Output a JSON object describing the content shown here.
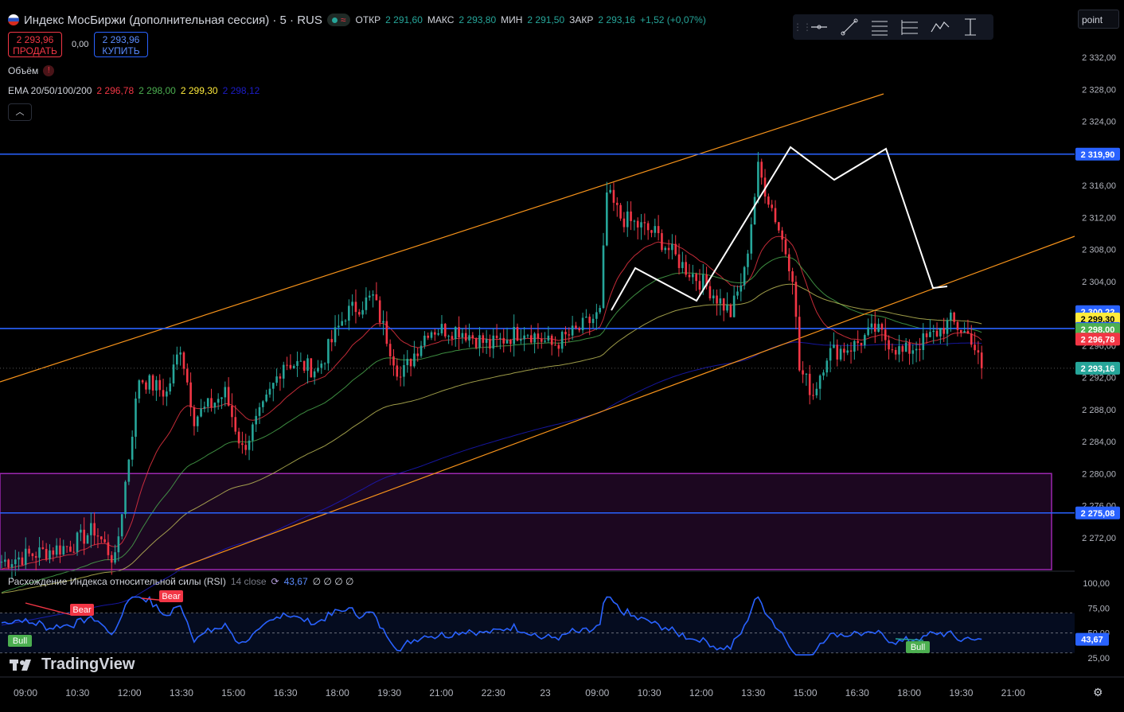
{
  "header": {
    "symbol_title": "Индекс МосБиржи (дополнительная сессия) · 5 · RUS",
    "ohlc": [
      {
        "label": "ОТКР",
        "value": "2 291,60"
      },
      {
        "label": "МАКС",
        "value": "2 293,80"
      },
      {
        "label": "МИН",
        "value": "2 291,50"
      },
      {
        "label": "ЗАКР",
        "value": "2 293,16"
      }
    ],
    "change": "+1,52 (+0,07%)"
  },
  "trade": {
    "sell_price": "2 293,96",
    "sell_label": "ПРОДАТЬ",
    "spread": "0,00",
    "buy_price": "2 293,96",
    "buy_label": "КУПИТЬ"
  },
  "indicators": {
    "volume_label": "Объём",
    "ema_label": "EMA 20/50/100/200",
    "ema_values": [
      {
        "value": "2 296,78",
        "color": "#f23645"
      },
      {
        "value": "2 298,00",
        "color": "#4caf50"
      },
      {
        "value": "2 299,30",
        "color": "#ffeb3b"
      },
      {
        "value": "2 298,12",
        "color": "#1c1cc7"
      }
    ]
  },
  "toolbar": {
    "point_value": "point",
    "tools": [
      "horizontal-line-icon",
      "trend-line-icon",
      "fib-retracement-icon",
      "parallel-channel-icon",
      "pattern-icon",
      "vertical-line-icon"
    ]
  },
  "colors": {
    "bull": "#26a69a",
    "bear": "#f23645",
    "hline": "#2962ff",
    "channel": "#f7931a",
    "zone": "#9c27b0",
    "pattern": "#ffffff",
    "rsi": "#2962ff"
  },
  "price_axis": {
    "ticks": [
      "2 332,00",
      "2 328,00",
      "2 324,00",
      "2 320,00",
      "2 316,00",
      "2 312,00",
      "2 308,00",
      "2 304,00",
      "2 300,00",
      "2 296,00",
      "2 292,00",
      "2 288,00",
      "2 284,00",
      "2 280,00",
      "2 276,00",
      "2 272,00"
    ],
    "tick_values": [
      2332,
      2328,
      2324,
      2320,
      2316,
      2312,
      2308,
      2304,
      2300,
      2296,
      2292,
      2288,
      2284,
      2280,
      2276,
      2272
    ],
    "badges": [
      {
        "text": "2 319,90",
        "value": 2319.9,
        "bg": "#2962ff",
        "fg": "#ffffff"
      },
      {
        "text": "2 300,22",
        "value": 2300.22,
        "bg": "#2962ff",
        "fg": "#ffffff"
      },
      {
        "text": "2 299,30",
        "value": 2299.3,
        "bg": "#ffeb3b",
        "fg": "#000000"
      },
      {
        "text": "2 298,12",
        "value": 2298.12,
        "bg": "#2962ff",
        "fg": "#ffffff"
      },
      {
        "text": "2 298,00",
        "value": 2298.0,
        "bg": "#4caf50",
        "fg": "#ffffff"
      },
      {
        "text": "2 296,78",
        "value": 2296.78,
        "bg": "#f23645",
        "fg": "#ffffff"
      },
      {
        "text": "2 293,16",
        "value": 2293.16,
        "bg": "#26a69a",
        "fg": "#ffffff"
      },
      {
        "text": "2 275,08",
        "value": 2275.08,
        "bg": "#2962ff",
        "fg": "#ffffff"
      }
    ]
  },
  "time_axis": {
    "labels": [
      "09:00",
      "10:30",
      "12:00",
      "13:30",
      "15:00",
      "16:30",
      "18:00",
      "19:30",
      "21:00",
      "22:30",
      "23",
      "09:00",
      "10:30",
      "12:00",
      "13:30",
      "15:00",
      "16:30",
      "18:00",
      "19:30",
      "21:00"
    ]
  },
  "levels": {
    "hlines": [
      2319.9,
      2298.12,
      2275.08
    ],
    "zone": {
      "from": 2280.0,
      "to": 2268.0
    }
  },
  "rsi": {
    "legend": "Расхождение Индекса относительной силы (RSI)",
    "params": "14 close",
    "value": "43,67",
    "extras": "∅ ∅ ∅ ∅",
    "axis_ticks": [
      "100,00",
      "75,00",
      "50,00",
      "25,00"
    ],
    "tick_values": [
      100,
      75,
      50,
      25
    ],
    "current": 43.67,
    "band": [
      30,
      70
    ],
    "signals": [
      {
        "text": "Bull",
        "kind": "bull"
      },
      {
        "text": "Bear",
        "kind": "bear"
      },
      {
        "text": "Bear",
        "kind": "bear"
      },
      {
        "text": "Bull",
        "kind": "bull"
      }
    ]
  },
  "chart_data": {
    "type": "candlestick",
    "symbol": "Индекс МосБиржи (дополнительная сессия)",
    "interval": "5",
    "y_range": [
      2268,
      2335
    ],
    "anchors": [
      [
        0,
        2269
      ],
      [
        10,
        2270
      ],
      [
        20,
        2271
      ],
      [
        27,
        2273
      ],
      [
        33,
        2269
      ],
      [
        40,
        2292
      ],
      [
        48,
        2290
      ],
      [
        52,
        2296
      ],
      [
        56,
        2287
      ],
      [
        65,
        2290
      ],
      [
        70,
        2283
      ],
      [
        76,
        2288
      ],
      [
        82,
        2294
      ],
      [
        92,
        2293
      ],
      [
        100,
        2300
      ],
      [
        108,
        2302
      ],
      [
        112,
        2297
      ],
      [
        116,
        2292
      ],
      [
        124,
        2298
      ],
      [
        133,
        2298
      ],
      [
        142,
        2296
      ],
      [
        152,
        2298
      ],
      [
        160,
        2296
      ],
      [
        168,
        2298
      ],
      [
        174,
        2300
      ],
      [
        176,
        2315
      ],
      [
        180,
        2312
      ],
      [
        190,
        2310
      ],
      [
        198,
        2306
      ],
      [
        206,
        2303
      ],
      [
        212,
        2300
      ],
      [
        216,
        2305
      ],
      [
        220,
        2318
      ],
      [
        225,
        2312
      ],
      [
        230,
        2305
      ],
      [
        232,
        2293
      ],
      [
        236,
        2290
      ],
      [
        240,
        2295
      ],
      [
        248,
        2296
      ],
      [
        254,
        2298
      ],
      [
        262,
        2295
      ],
      [
        270,
        2297
      ],
      [
        276,
        2299
      ],
      [
        282,
        2297
      ],
      [
        285,
        2293
      ]
    ],
    "candles": 286
  }
}
